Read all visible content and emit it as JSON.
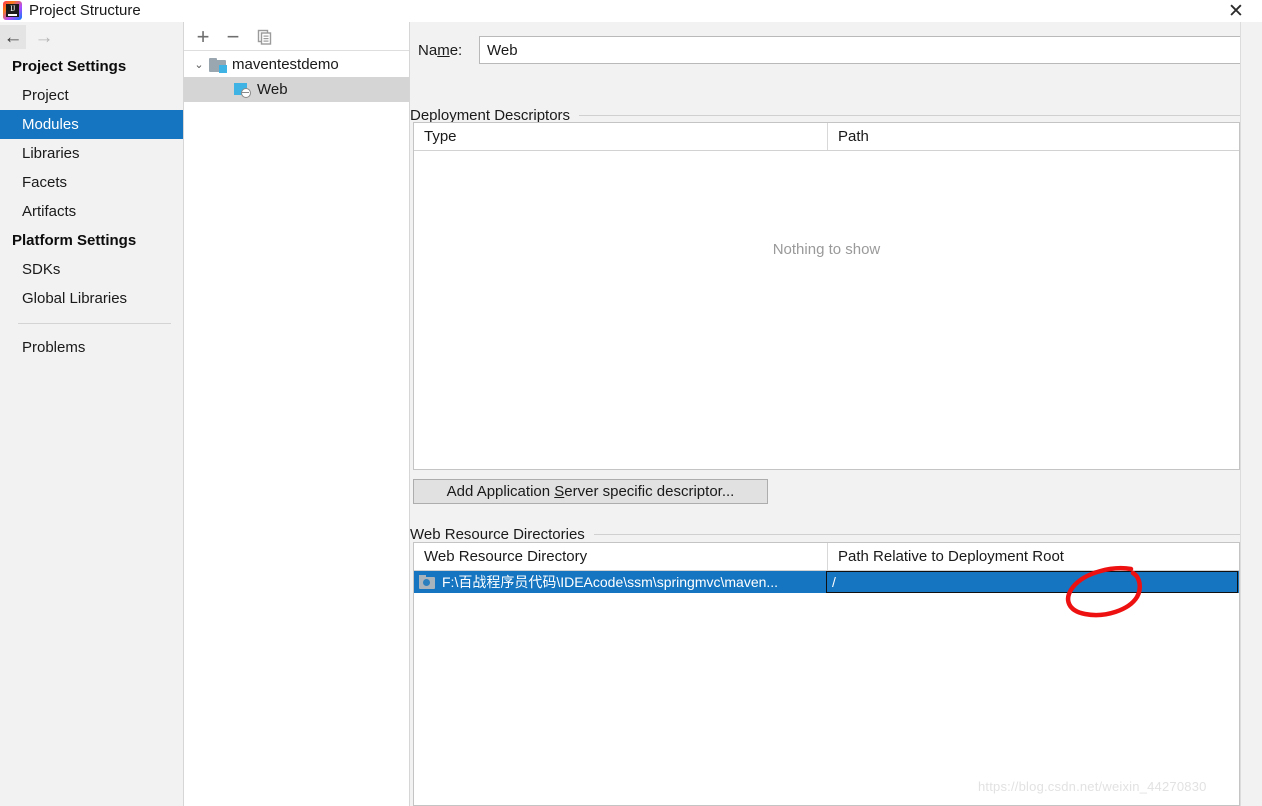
{
  "window": {
    "title": "Project Structure",
    "app_icon": "intellij-idea-logo",
    "close_label": "✕"
  },
  "nav": {
    "back_icon": "arrow-left-icon",
    "back_glyph": "←",
    "forward_icon": "arrow-right-icon",
    "forward_glyph": "→"
  },
  "sidebar": {
    "groups": [
      {
        "label": "Project Settings",
        "items": [
          {
            "label": "Project",
            "selected": false
          },
          {
            "label": "Modules",
            "selected": true
          },
          {
            "label": "Libraries",
            "selected": false
          },
          {
            "label": "Facets",
            "selected": false
          },
          {
            "label": "Artifacts",
            "selected": false
          }
        ]
      },
      {
        "label": "Platform Settings",
        "items": [
          {
            "label": "SDKs",
            "selected": false
          },
          {
            "label": "Global Libraries",
            "selected": false
          }
        ]
      }
    ],
    "footer_items": [
      {
        "label": "Problems",
        "selected": false
      }
    ],
    "selected_color": "#1675c0"
  },
  "tree": {
    "toolbar": {
      "add_label": "+",
      "add_icon": "plus-icon",
      "remove_label": "−",
      "remove_icon": "minus-icon",
      "copy_icon": "copy-icon"
    },
    "nodes": [
      {
        "label": "maventestdemo",
        "icon": "module-folder-icon",
        "expanded": true,
        "expand_glyph": "⌄",
        "selected": false,
        "indent": 0
      },
      {
        "label": "Web",
        "icon": "web-facet-icon",
        "expanded": false,
        "expand_glyph": "",
        "selected": true,
        "indent": 1
      }
    ]
  },
  "main": {
    "name_field": {
      "label_pre": "Na",
      "label_mnemonic": "m",
      "label_post": "e:",
      "value": "Web",
      "placeholder": ""
    },
    "deployment_descriptors": {
      "section_title": "Deployment Descriptors",
      "columns": [
        "Type",
        "Path"
      ],
      "rows": [],
      "empty_text": "Nothing to show",
      "tools": [
        {
          "icon": "plus-icon",
          "glyph": "+"
        },
        {
          "icon": "minus-icon",
          "glyph": "−"
        },
        {
          "icon": "pencil-edit-icon",
          "glyph": ""
        }
      ]
    },
    "add_descriptor_button": {
      "label_pre": "Add Application ",
      "label_mnemonic": "S",
      "label_post": "erver specific descriptor..."
    },
    "web_resource_directories": {
      "section_title": "Web Resource Directories",
      "columns": [
        "Web Resource Directory",
        "Path Relative to Deployment Root"
      ],
      "rows": [
        {
          "directory": "F:\\百战程序员代码\\IDEAcode\\ssm\\springmvc\\maven...",
          "relative_path": "/",
          "selected": true,
          "icon": "resource-folder-icon"
        }
      ],
      "tools": [
        {
          "icon": "plus-icon",
          "glyph": "+"
        },
        {
          "icon": "minus-icon",
          "glyph": "−"
        },
        {
          "icon": "pencil-edit-icon",
          "glyph": ""
        },
        {
          "icon": "help-question-icon",
          "glyph": "?"
        }
      ]
    }
  },
  "annotation": {
    "shape": "hand-drawn-red-ellipse",
    "color": "#ee1111"
  },
  "watermark": {
    "text": "https://blog.csdn.net/weixin_44270830"
  }
}
